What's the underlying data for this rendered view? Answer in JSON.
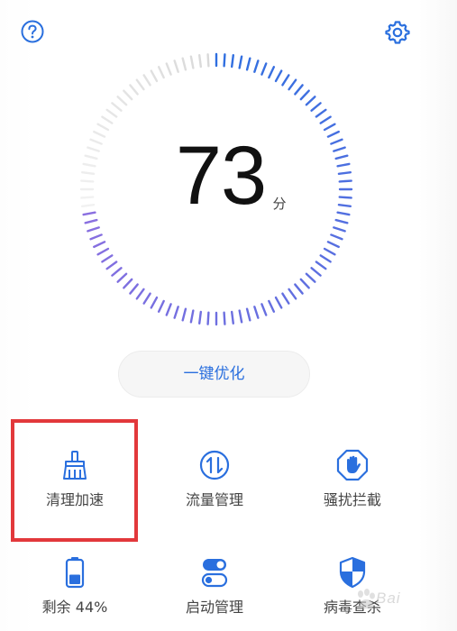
{
  "score": {
    "value": "73",
    "unit": "分",
    "level": 0.73
  },
  "optimize": {
    "label": "一键优化"
  },
  "tiles": [
    {
      "label": "清理加速",
      "icon": "broom-icon"
    },
    {
      "label": "流量管理",
      "icon": "data-traffic-icon"
    },
    {
      "label": "骚扰拦截",
      "icon": "block-hand-icon"
    },
    {
      "label": "剩余 44%",
      "icon": "battery-icon",
      "battery_level": 0.44
    },
    {
      "label": "启动管理",
      "icon": "startup-toggle-icon"
    },
    {
      "label": "病毒查杀",
      "icon": "shield-icon"
    }
  ],
  "watermark": {
    "text": "Bai"
  },
  "colors": {
    "accent": "#2a6fde",
    "gauge_start": "#2f6fe0",
    "gauge_end": "#8a6fe0",
    "gauge_track": "#d8d8d8",
    "highlight": "#e2383b"
  }
}
